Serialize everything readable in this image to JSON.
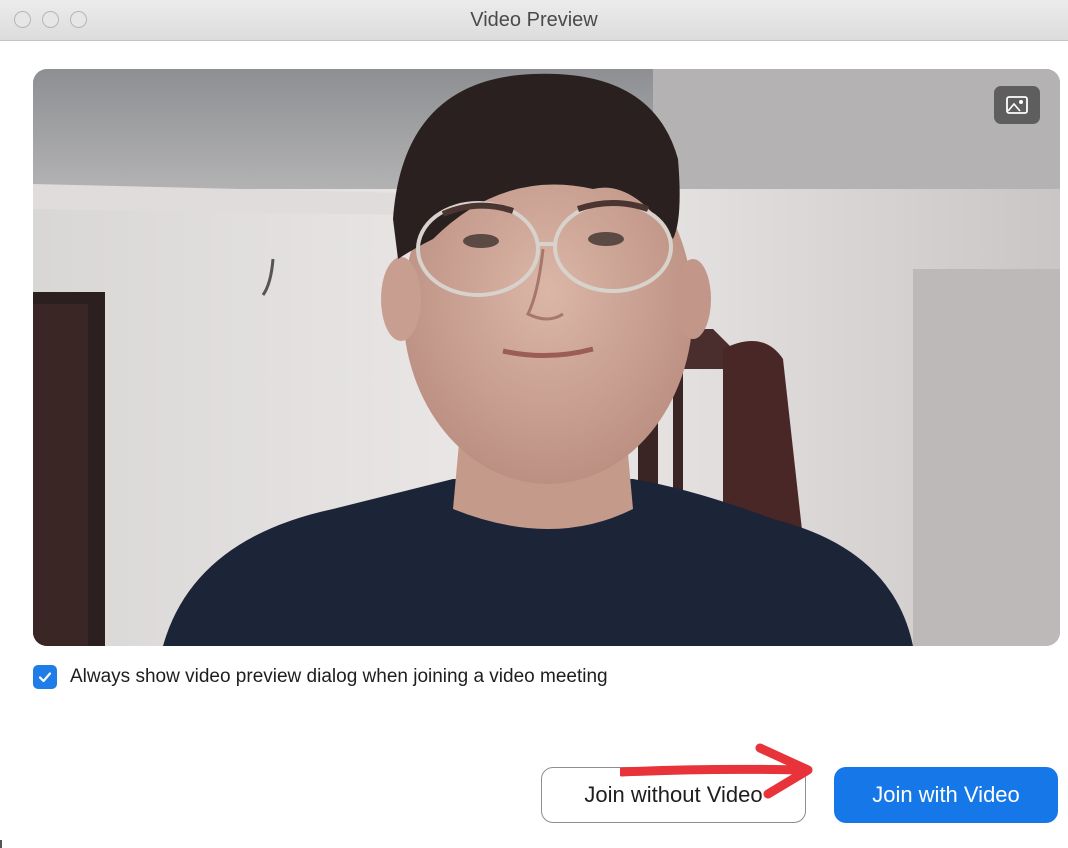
{
  "window": {
    "title": "Video Preview"
  },
  "video": {
    "background_icon": "virtual-background-icon"
  },
  "checkbox": {
    "label": "Always show video preview dialog when joining a video meeting",
    "checked": true
  },
  "buttons": {
    "join_without_video": "Join without Video",
    "join_with_video": "Join with Video"
  },
  "colors": {
    "accent_blue": "#1577e8",
    "checkbox_blue": "#1f7de8",
    "annotation_arrow": "#e8333b"
  }
}
